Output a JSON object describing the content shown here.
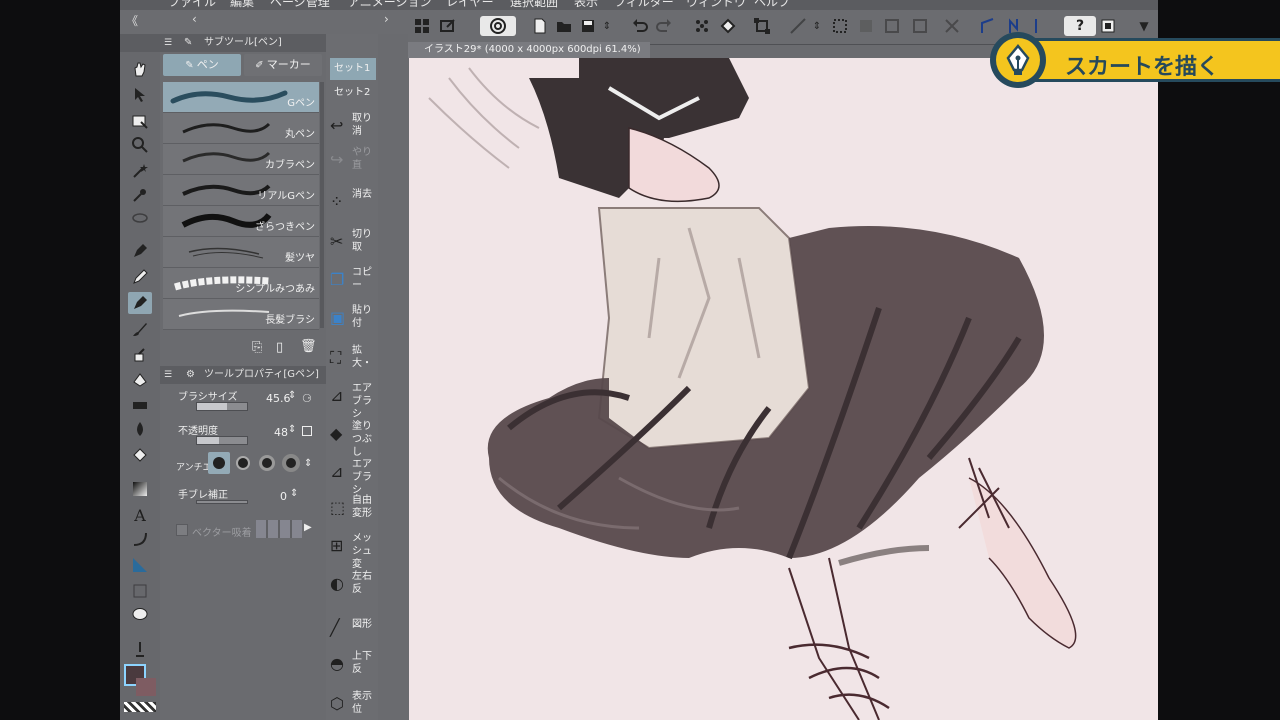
{
  "menu": [
    "ファイル",
    "編集",
    "ページ管理",
    "アニメーション",
    "レイヤー",
    "選択範囲",
    "表示",
    "フィルター",
    "ウィンドウ",
    "ヘルプ"
  ],
  "document": {
    "tab_title": "イラスト29* (4000 x 4000px 600dpi 61.4%)"
  },
  "subtool_panel": {
    "title": "サブツール[ペン]",
    "tabs": [
      "ペン",
      "マーカー"
    ],
    "brushes": [
      "Gペン",
      "丸ペン",
      "カブラペン",
      "リアルGペン",
      "ざらつきペン",
      "髪ツヤ",
      "シンプルみつあみ",
      "長髪ブラシ"
    ],
    "selected_brush": "Gペン"
  },
  "tool_property": {
    "title": "ツールプロパティ[Gペン]",
    "brush_size_label": "ブラシサイズ",
    "brush_size_value": "45.6",
    "opacity_label": "不透明度",
    "opacity_value": "48",
    "antialias_label": "アンチエ",
    "stabilization_label": "手ブレ補正",
    "stabilization_value": "0",
    "vector_snap_label": "ベクター吸着"
  },
  "command_bar": {
    "sets": [
      "セット1",
      "セット2"
    ],
    "items": [
      {
        "icon": "undo-icon",
        "label": "取り消"
      },
      {
        "icon": "redo-icon",
        "label": "やり直"
      },
      {
        "icon": "erase-icon",
        "label": "消去"
      },
      {
        "icon": "scissors-icon",
        "label": "切り取"
      },
      {
        "icon": "copy-icon",
        "label": "コピー"
      },
      {
        "icon": "paste-icon",
        "label": "貼り付"
      },
      {
        "icon": "scale-icon",
        "label": "拡大・"
      },
      {
        "icon": "airbrush-icon",
        "label": "エアブラシ"
      },
      {
        "icon": "fill-icon",
        "label": "塗りつぶし"
      },
      {
        "icon": "airbrush2-icon",
        "label": "エアブラシ"
      },
      {
        "icon": "free-transform-icon",
        "label": "自由変形"
      },
      {
        "icon": "mesh-icon",
        "label": "メッシュ変"
      },
      {
        "icon": "flip-horizontal-icon",
        "label": "左右反"
      },
      {
        "icon": "shape-icon",
        "label": "図形"
      },
      {
        "icon": "flip-vertical-icon",
        "label": "上下反"
      },
      {
        "icon": "display-position-icon",
        "label": "表示位"
      }
    ]
  },
  "caption": {
    "text": "スカートを描く"
  },
  "colors": {
    "accent": "#f4c51e",
    "caption_text": "#26495b",
    "canvas_bg": "#f1e5e7",
    "selected": "#93aab6"
  }
}
